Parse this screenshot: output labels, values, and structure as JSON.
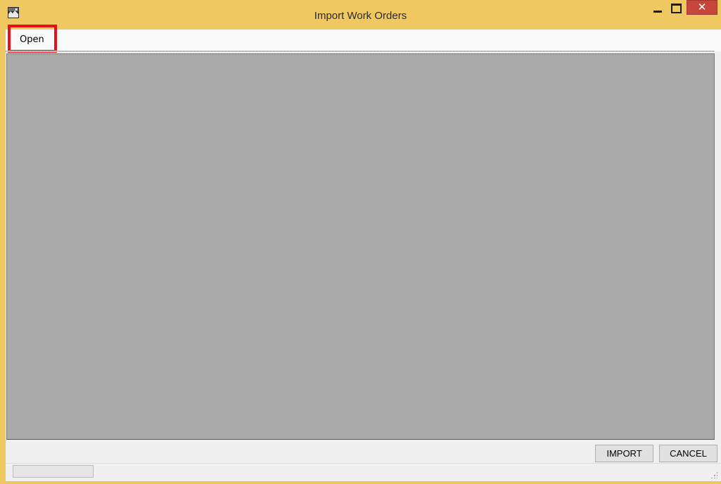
{
  "window": {
    "title": "Import Work Orders",
    "close_glyph": "✕"
  },
  "menu": {
    "items": [
      {
        "label": "Open"
      }
    ]
  },
  "actions": {
    "import_label": "IMPORT",
    "cancel_label": "CANCEL"
  },
  "status": {
    "progress": 0
  },
  "colors": {
    "frame": "#f0c862",
    "close_button": "#c7463b",
    "highlight": "#e3121b",
    "content_bg": "#aaaaaa"
  },
  "icons": {
    "app": "app-icon",
    "minimize": "minimize-icon",
    "maximize": "maximize-icon",
    "close": "close-icon",
    "resize_grip": "resize-grip-icon"
  }
}
